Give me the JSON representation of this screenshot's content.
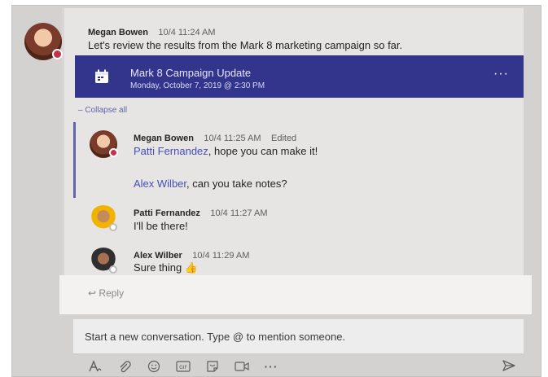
{
  "thread": {
    "root": {
      "author": "Megan Bowen",
      "time": "10/4 11:24 AM",
      "text": "Let's review the results from the Mark 8 marketing campaign so far."
    },
    "event": {
      "title": "Mark 8 Campaign Update",
      "date": "Monday, October 7, 2019 @ 2:30 PM",
      "more_label": "···"
    },
    "collapse_label": "– Collapse all",
    "replies": [
      {
        "author": "Megan Bowen",
        "time": "10/4 11:25 AM",
        "edited": "Edited",
        "line1_mention": "Patti Fernandez",
        "line1_rest": ", hope you can make it!",
        "line2_mention": "Alex Wilber",
        "line2_rest": ", can you take notes?"
      },
      {
        "author": "Patti Fernandez",
        "time": "10/4 11:27 AM",
        "text": "I'll be there!"
      },
      {
        "author": "Alex Wilber",
        "time": "10/4 11:29 AM",
        "text": "Sure thing",
        "emoji": "👍"
      }
    ],
    "reply_label": "Reply",
    "reply_icon": "↩"
  },
  "compose": {
    "placeholder": "Start a new conversation. Type @ to mention someone."
  },
  "toolbar": {
    "icons": [
      "format-icon",
      "attach-icon",
      "emoji-icon",
      "gif-icon",
      "sticker-icon",
      "meet-now-icon",
      "more-options-icon"
    ],
    "more_label": "···",
    "gif_label": "GIF"
  },
  "colors": {
    "event_card": "#33348c",
    "mention": "#464eb8",
    "presence_busy": "#c4314b",
    "accent": "#6264a7"
  }
}
